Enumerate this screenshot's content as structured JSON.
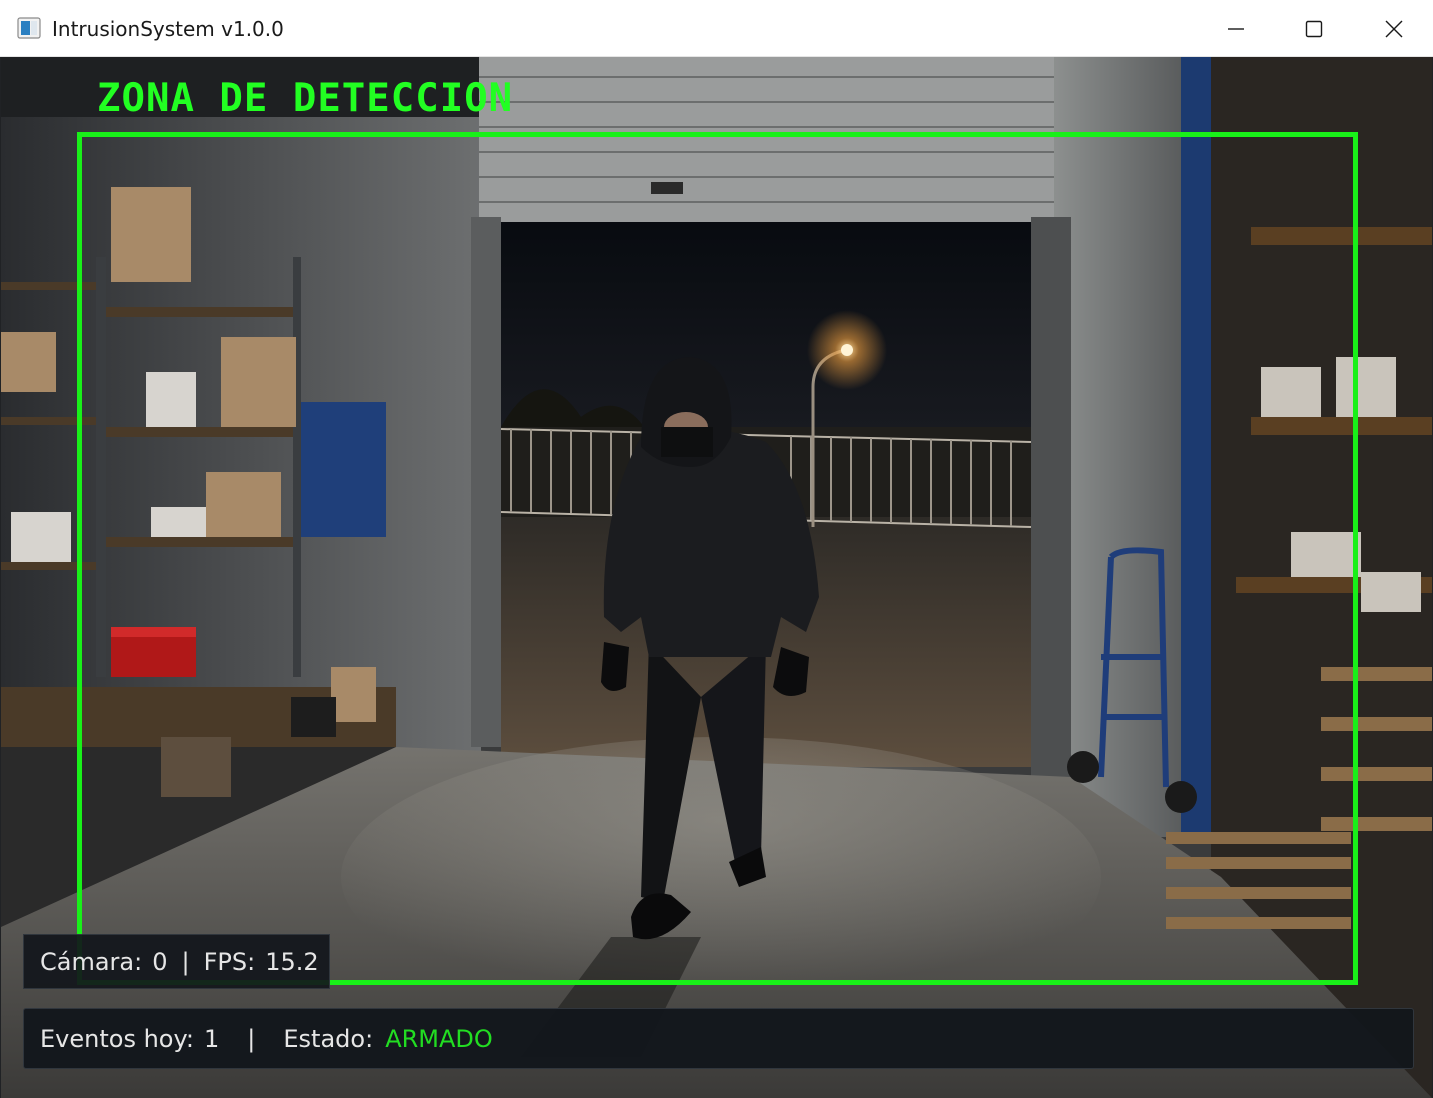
{
  "window": {
    "title": "IntrusionSystem v1.0.0",
    "controls": [
      "minimize-icon",
      "maximize-icon",
      "close-icon"
    ]
  },
  "overlay": {
    "zone_label": "ZONA DE DETECCION",
    "zone_color": "#19f019"
  },
  "camera_info": {
    "camera_label": "Cámara:",
    "camera_value": "0",
    "separator": "|",
    "fps_label": "FPS:",
    "fps_value": "15.2"
  },
  "status": {
    "events_label": "Eventos hoy:",
    "events_value": "1",
    "separator": "|",
    "state_label": "Estado:",
    "state_value": "ARMADO",
    "state_color": "#22dd22"
  }
}
